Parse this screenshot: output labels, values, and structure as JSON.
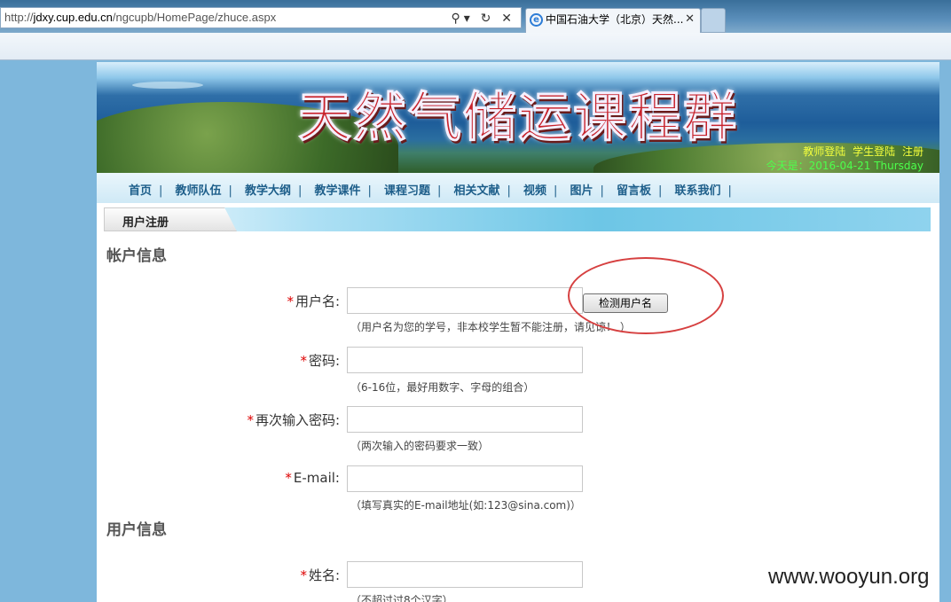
{
  "browser": {
    "address": {
      "prefix": "http://",
      "host": "jdxy.cup.edu.cn",
      "path": "/ngcupb/HomePage/zhuce.aspx"
    },
    "address_icons": "⚲▾ ↻ ✕",
    "tab": {
      "title": "中国石油大学（北京）天然...",
      "icon": "ie-icon",
      "close": "✕"
    }
  },
  "banner": {
    "title": "天然气储运课程群",
    "links": [
      "教师登陆",
      "学生登陆",
      "注册"
    ],
    "date": "今天是：2016-04-21  Thursday"
  },
  "nav": {
    "items": [
      "首页",
      "教师队伍",
      "教学大纲",
      "教学课件",
      "课程习题",
      "相关文献",
      "视频",
      "图片",
      "留言板",
      "联系我们"
    ],
    "separator": "|"
  },
  "section": {
    "title": "用户注册"
  },
  "account": {
    "title": "帐户信息",
    "required_mark": "*",
    "username": {
      "label": "用户名:",
      "value": "",
      "hint": "（用户名为您的学号，非本校学生暂不能注册，请见谅！  ）"
    },
    "check_button": "检测用户名",
    "password": {
      "label": "密码:",
      "value": "",
      "hint": "（6-16位，最好用数字、字母的组合）"
    },
    "password_confirm": {
      "label": "再次输入密码:",
      "value": "",
      "hint": "（两次输入的密码要求一致）"
    },
    "email": {
      "label": "E-mail:",
      "value": "",
      "hint": "（填写真实的E-mail地址(如:123@sina.com)）"
    }
  },
  "user": {
    "title": "用户信息",
    "name": {
      "label": "姓名:",
      "value": "",
      "hint": "（不超过过8个汉字）"
    }
  },
  "watermark": "www.wooyun.org",
  "colors": {
    "required": "#dd0000",
    "nav_text": "#1d5e8a",
    "annotation": "#d64040"
  }
}
